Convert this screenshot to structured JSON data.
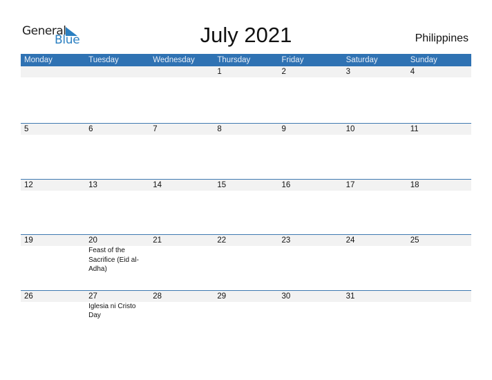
{
  "logo": {
    "word1": "General",
    "word2": "Blue"
  },
  "header": {
    "title": "July 2021",
    "country": "Philippines"
  },
  "colors": {
    "accent": "#2f72b3",
    "day_bar": "#f2f2f2"
  },
  "weekdays": [
    "Monday",
    "Tuesday",
    "Wednesday",
    "Thursday",
    "Friday",
    "Saturday",
    "Sunday"
  ],
  "weeks": [
    {
      "days": [
        "",
        "",
        "",
        "1",
        "2",
        "3",
        "4"
      ],
      "events": [
        "",
        "",
        "",
        "",
        "",
        "",
        ""
      ]
    },
    {
      "days": [
        "5",
        "6",
        "7",
        "8",
        "9",
        "10",
        "11"
      ],
      "events": [
        "",
        "",
        "",
        "",
        "",
        "",
        ""
      ]
    },
    {
      "days": [
        "12",
        "13",
        "14",
        "15",
        "16",
        "17",
        "18"
      ],
      "events": [
        "",
        "",
        "",
        "",
        "",
        "",
        ""
      ]
    },
    {
      "days": [
        "19",
        "20",
        "21",
        "22",
        "23",
        "24",
        "25"
      ],
      "events": [
        "",
        "Feast of the Sacrifice (Eid al-Adha)",
        "",
        "",
        "",
        "",
        ""
      ]
    },
    {
      "days": [
        "26",
        "27",
        "28",
        "29",
        "30",
        "31",
        ""
      ],
      "events": [
        "",
        "Iglesia ni Cristo Day",
        "",
        "",
        "",
        "",
        ""
      ]
    }
  ]
}
